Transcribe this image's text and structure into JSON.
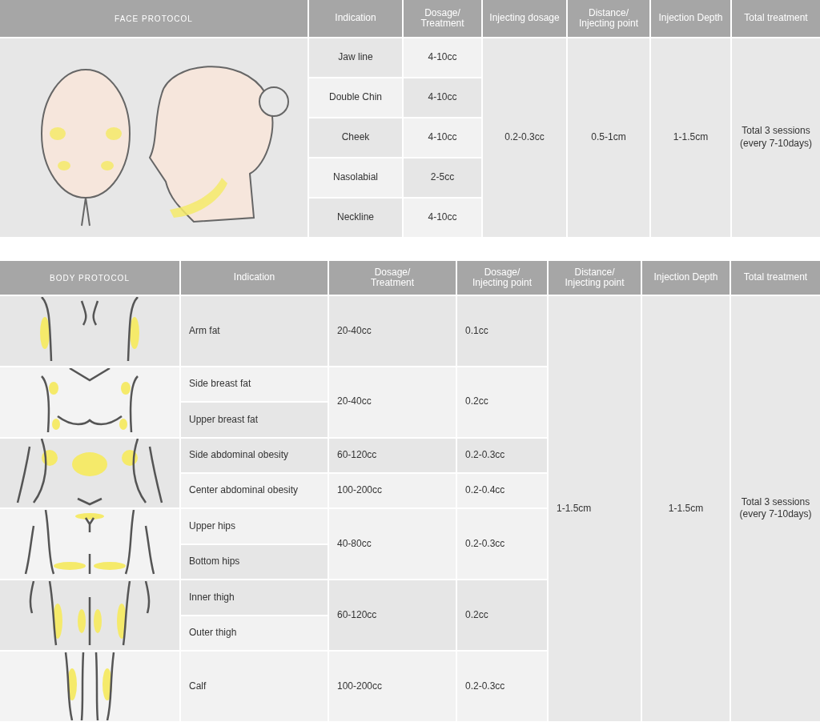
{
  "face_protocol": {
    "title": "FACE PROTOCOL",
    "columns": [
      "Indication",
      "Dosage/\nTreatment",
      "Injecting dosage",
      "Distance/\nInjecting point",
      "Injection Depth",
      "Total treatment"
    ],
    "rows": [
      {
        "indication": "Jaw line",
        "dosage": "4-10cc"
      },
      {
        "indication": "Double Chin",
        "dosage": "4-10cc"
      },
      {
        "indication": "Cheek",
        "dosage": "4-10cc"
      },
      {
        "indication": "Nasolabial",
        "dosage": "2-5cc"
      },
      {
        "indication": "Neckline",
        "dosage": "4-10cc"
      }
    ],
    "injecting_dosage": "0.2-0.3cc",
    "distance": "0.5-1cm",
    "depth": "1-1.5cm",
    "total": "Total 3 sessions\n(every 7-10days)"
  },
  "body_protocol": {
    "title": "BODY PROTOCOL",
    "columns": [
      "Indication",
      "Dosage/\nTreatment",
      "Dosage/\nInjecting point",
      "Distance/\nInjecting point",
      "Injection Depth",
      "Total treatment"
    ],
    "groups": [
      {
        "indications": [
          "Arm fat"
        ],
        "dosages": [
          "20-40cc"
        ],
        "points": [
          "0.1cc"
        ]
      },
      {
        "indications": [
          "Side breast fat",
          "Upper breast fat"
        ],
        "dosages": [
          "20-40cc"
        ],
        "points": [
          "0.2cc"
        ]
      },
      {
        "indications": [
          "Side abdominal obesity",
          "Center abdominal obesity"
        ],
        "dosages": [
          "60-120cc",
          "100-200cc"
        ],
        "points": [
          "0.2-0.3cc",
          "0.2-0.4cc"
        ]
      },
      {
        "indications": [
          "Upper hips",
          "Bottom hips"
        ],
        "dosages": [
          "40-80cc"
        ],
        "points": [
          "0.2-0.3cc"
        ]
      },
      {
        "indications": [
          "Inner thigh",
          "Outer thigh"
        ],
        "dosages": [
          "60-120cc"
        ],
        "points": [
          "0.2cc"
        ]
      },
      {
        "indications": [
          "Calf"
        ],
        "dosages": [
          "100-200cc"
        ],
        "points": [
          "0.2-0.3cc"
        ]
      }
    ],
    "distance": "1-1.5cm",
    "depth": "1-1.5cm",
    "total": "Total 3 sessions\n(every 7-10days)"
  }
}
